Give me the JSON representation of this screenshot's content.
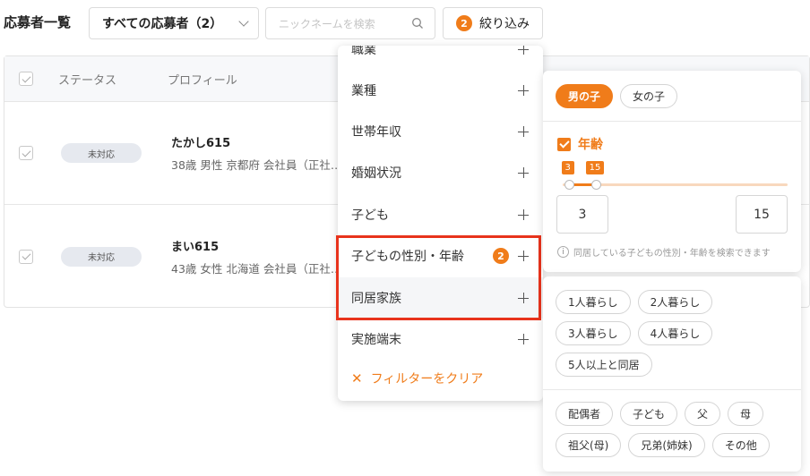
{
  "header": {
    "title": "応募者一覧",
    "applicant_select": "すべての応募者（2）",
    "search_placeholder": "ニックネームを検索",
    "filter_label": "絞り込み",
    "filter_count": "2"
  },
  "table": {
    "columns": [
      "ステータス",
      "プロフィール"
    ],
    "rows": [
      {
        "status": "未対応",
        "name": "たかし615",
        "meta": "38歳 男性 京都府 会社員（正社…"
      },
      {
        "status": "未対応",
        "name": "まい615",
        "meta": "43歳 女性 北海道 会社員（正社…"
      }
    ]
  },
  "filter_menu": {
    "items": [
      {
        "label": "職業"
      },
      {
        "label": "業種"
      },
      {
        "label": "世帯年収"
      },
      {
        "label": "婚姻状況"
      },
      {
        "label": "子ども"
      },
      {
        "label": "子どもの性別・年齢",
        "count": "2"
      },
      {
        "label": "同居家族"
      },
      {
        "label": "実施端末"
      }
    ],
    "clear_label": "フィルターをクリア"
  },
  "child_panel": {
    "genders": [
      "男の子",
      "女の子"
    ],
    "age_label": "年齢",
    "age_min": "3",
    "age_max": "15",
    "slider_min_fraction": 0.03,
    "slider_max_fraction": 0.15,
    "hint": "同居している子どもの性別・年齢を検索できます"
  },
  "household_panel": {
    "living_options": [
      "1人暮らし",
      "2人暮らし",
      "3人暮らし",
      "4人暮らし",
      "5人以上と同居"
    ],
    "member_options": [
      "配偶者",
      "子ども",
      "父",
      "母",
      "祖父(母)",
      "兄弟(姉妹)",
      "その他"
    ]
  },
  "colors": {
    "accent": "#f07c1a",
    "highlight": "#e8331c"
  }
}
